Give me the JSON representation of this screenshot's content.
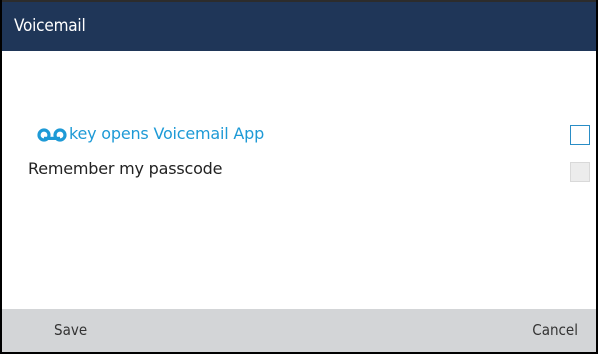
{
  "header": {
    "title": "Voicemail"
  },
  "settings": {
    "voicemail_key": {
      "icon": "voicemail-icon",
      "label": "key opens Voicemail App",
      "checked": false
    },
    "remember_passcode": {
      "label": "Remember my passcode",
      "checked": false,
      "disabled": true
    }
  },
  "softkeys": {
    "save_label": "Save",
    "cancel_label": "Cancel"
  },
  "colors": {
    "header_bg": "#1f3658",
    "accent": "#1e9ad6",
    "softkey_bar": "#d3d5d7"
  }
}
